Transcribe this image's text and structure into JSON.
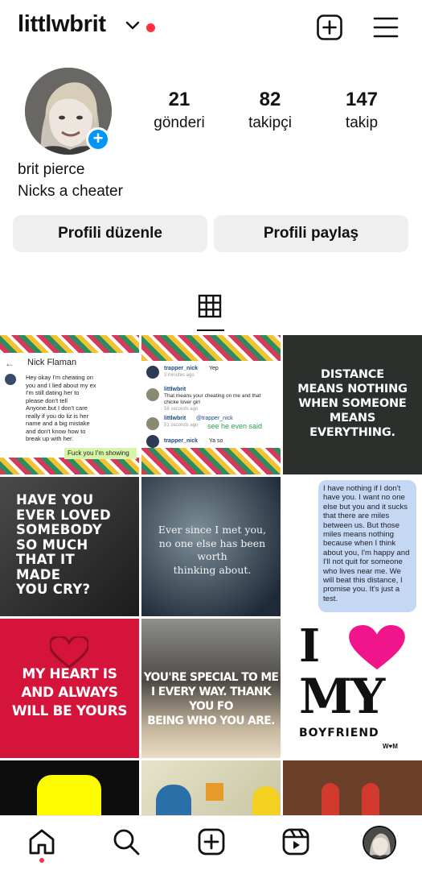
{
  "header": {
    "username": "littlwbrit"
  },
  "profile": {
    "display_name": "brit pierce",
    "bio": "Nicks a cheater",
    "stats": [
      {
        "value": "21",
        "label": "gönderi"
      },
      {
        "value": "82",
        "label": "takipçi"
      },
      {
        "value": "147",
        "label": "takip"
      }
    ],
    "add_story_glyph": "+"
  },
  "actions": {
    "edit_profile": "Profili düzenle",
    "share_profile": "Profili paylaş"
  },
  "posts": {
    "p1": {
      "contact": "Nick Flaman",
      "message": "Hey okay I'm cheating on you and I lied about my ex I'm still dating her to please don't tell Anyone.but I don't care really if you do liz is her name and a big mistake and don't know how to break up with her.",
      "reply": "Fuck you I'm showing"
    },
    "p2": {
      "c1_user": "trapper_nick",
      "c1_text": "Yep",
      "c1_time": "3 minutes ago",
      "c2_user": "littlwbrit",
      "c2_text": "That means your cheating on me and that chicke  lover girl",
      "c2_time": "58 seconds ago",
      "c3_user": "littlwbrit",
      "c3_text": "@trapper_nick",
      "c3_time": "51 seconds ago",
      "c3_extra": "see he even said",
      "c4_user": "trapper_nick",
      "c4_text": "Ya so"
    },
    "p3": {
      "lines": [
        "DISTANCE",
        "MEANS NOTHING",
        "WHEN SOMEONE",
        "MEANS",
        "EVERYTHING."
      ]
    },
    "p4": {
      "lines": [
        "HAVE YOU",
        "EVER LOVED",
        "SOMEBODY",
        "SO MUCH",
        "THAT IT",
        "MADE",
        "YOU CRY?"
      ]
    },
    "p5": {
      "lines": [
        "Ever since I met you,",
        "no one else has been worth",
        "thinking about."
      ]
    },
    "p6": {
      "text": "I have nothing if I don't have you. I want no one else but you and it sucks that there are miles between us. But those miles means nothing because when I think about you, I'm happy and I'll not quit for someone who lives near me. We will beat this distance, I promise you. It's just a test."
    },
    "p7": {
      "lines": [
        "MY HEART IS",
        "AND ALWAYS",
        "WILL BE YOURS"
      ]
    },
    "p8": {
      "lines": [
        "YOU'RE SPECIAL TO ME",
        "I EVERY WAY. THANK YOU FO",
        "BEING WHO YOU ARE."
      ]
    },
    "p9": {
      "lines": [
        "I",
        "MY",
        "BOYFRIEND"
      ],
      "mark": "W♥M"
    }
  },
  "colors": {
    "accent_blue": "#0095f6",
    "notification_red": "#ff3040",
    "button_bg": "#efefef"
  },
  "icons": {
    "create": "plus-square-icon",
    "menu": "hamburger-menu-icon",
    "grid": "grid-icon",
    "nav": [
      "home-icon",
      "search-icon",
      "create-icon",
      "reels-icon",
      "profile-avatar"
    ]
  }
}
